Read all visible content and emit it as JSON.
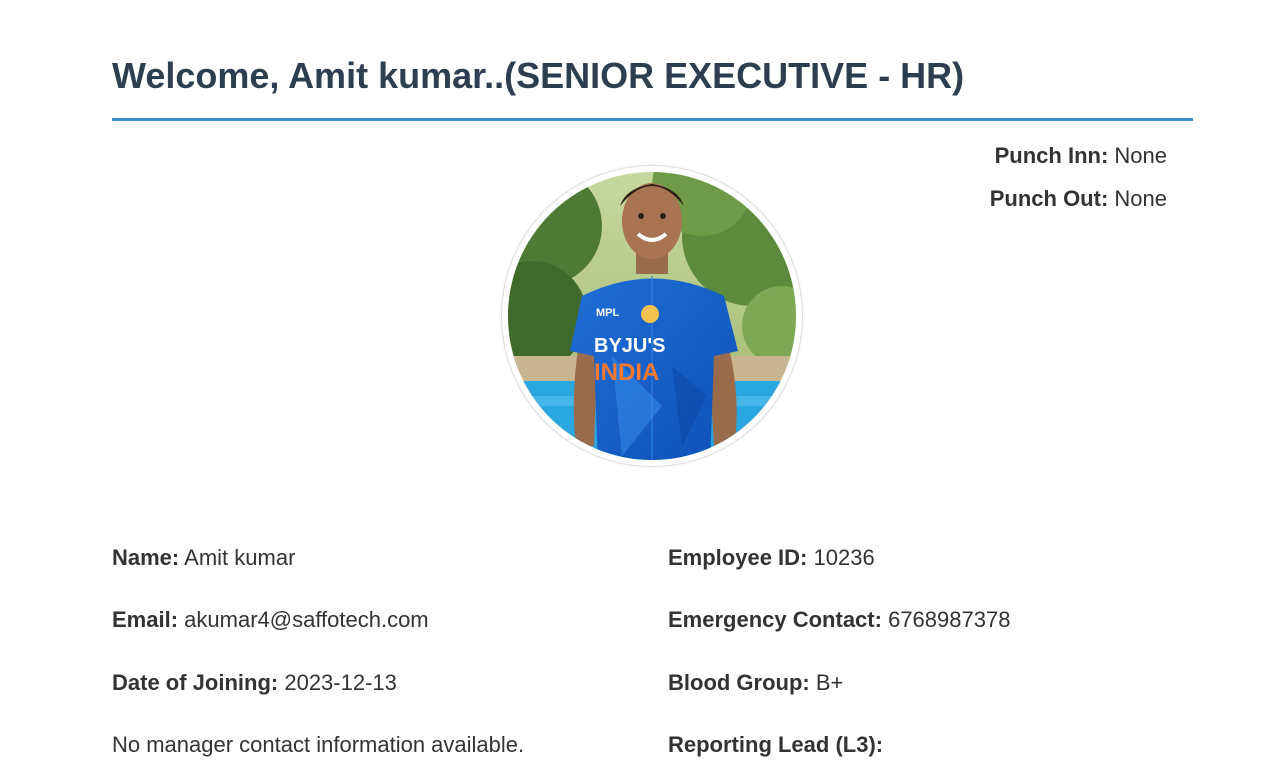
{
  "header": {
    "title": "Welcome, Amit kumar..(SENIOR EXECUTIVE - HR)"
  },
  "punch": {
    "in_label": "Punch Inn:",
    "in_value": "None",
    "out_label": "Punch Out:",
    "out_value": "None"
  },
  "profile": {
    "jersey_sponsor": "BYJU'S",
    "jersey_team": "INDIA",
    "jersey_brand": "MPL"
  },
  "details": {
    "name_label": "Name:",
    "name_value": "Amit kumar",
    "email_label": "Email:",
    "email_value": "akumar4@saffotech.com",
    "doj_label": "Date of Joining:",
    "doj_value": "2023-12-13",
    "manager_note": "No manager contact information available.",
    "employee_id_label": "Employee ID:",
    "employee_id_value": "10236",
    "emergency_label": "Emergency Contact:",
    "emergency_value": "6768987378",
    "blood_label": "Blood Group:",
    "blood_value": "B+",
    "reporting_label": "Reporting Lead (L3):",
    "reporting_value": ""
  },
  "colors": {
    "title": "#2c3e50",
    "rule": "#3a8fd0",
    "text": "#333333"
  }
}
